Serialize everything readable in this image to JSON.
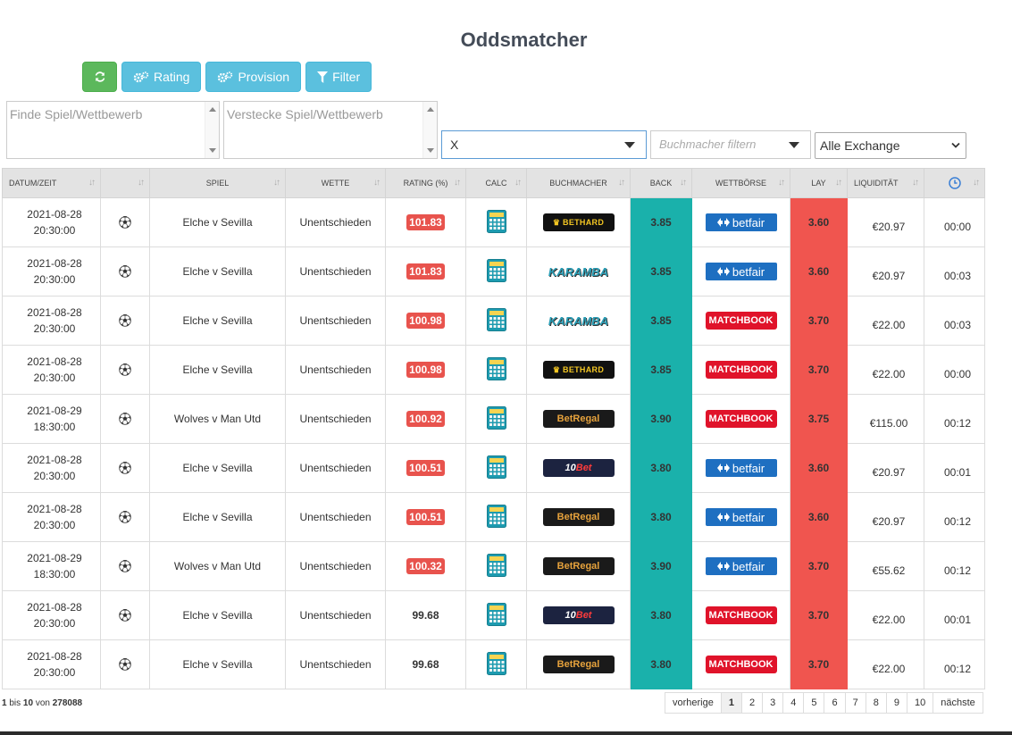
{
  "title": "Oddsmatcher",
  "toolbar": {
    "refresh_icon": "refresh-icon",
    "rating_label": "Rating",
    "provision_label": "Provision",
    "filter_label": "Filter"
  },
  "filters": {
    "find_placeholder": "Finde Spiel/Wettbewerb",
    "hide_placeholder": "Verstecke Spiel/Wettbewerb",
    "bet_select_value": "X",
    "bookmaker_placeholder": "Buchmacher filtern",
    "exchange_select_value": "Alle Exchange"
  },
  "table": {
    "headers": [
      "Datum/Zeit",
      "",
      "Spiel",
      "Wette",
      "Rating (%)",
      "Calc",
      "Buchmacher",
      "Back",
      "Wettbörse",
      "Lay",
      "Liquidität",
      ""
    ],
    "rows": [
      {
        "date": "2021-08-28",
        "time": "20:30:00",
        "game": "Elche v Sevilla",
        "bet": "Unentschieden",
        "rating": "101.83",
        "highlight": true,
        "bookmaker": "BETHARD",
        "back": "3.85",
        "exchange": "betfair",
        "lay": "3.60",
        "liquidity": "€20.97",
        "age": "00:00"
      },
      {
        "date": "2021-08-28",
        "time": "20:30:00",
        "game": "Elche v Sevilla",
        "bet": "Unentschieden",
        "rating": "101.83",
        "highlight": true,
        "bookmaker": "KARAMBA",
        "back": "3.85",
        "exchange": "betfair",
        "lay": "3.60",
        "liquidity": "€20.97",
        "age": "00:03"
      },
      {
        "date": "2021-08-28",
        "time": "20:30:00",
        "game": "Elche v Sevilla",
        "bet": "Unentschieden",
        "rating": "100.98",
        "highlight": true,
        "bookmaker": "KARAMBA",
        "back": "3.85",
        "exchange": "MATCHBOOK",
        "lay": "3.70",
        "liquidity": "€22.00",
        "age": "00:03"
      },
      {
        "date": "2021-08-28",
        "time": "20:30:00",
        "game": "Elche v Sevilla",
        "bet": "Unentschieden",
        "rating": "100.98",
        "highlight": true,
        "bookmaker": "BETHARD",
        "back": "3.85",
        "exchange": "MATCHBOOK",
        "lay": "3.70",
        "liquidity": "€22.00",
        "age": "00:00"
      },
      {
        "date": "2021-08-29",
        "time": "18:30:00",
        "game": "Wolves v Man Utd",
        "bet": "Unentschieden",
        "rating": "100.92",
        "highlight": true,
        "bookmaker": "BetRegal",
        "back": "3.90",
        "exchange": "MATCHBOOK",
        "lay": "3.75",
        "liquidity": "€115.00",
        "age": "00:12"
      },
      {
        "date": "2021-08-28",
        "time": "20:30:00",
        "game": "Elche v Sevilla",
        "bet": "Unentschieden",
        "rating": "100.51",
        "highlight": true,
        "bookmaker": "10Bet",
        "back": "3.80",
        "exchange": "betfair",
        "lay": "3.60",
        "liquidity": "€20.97",
        "age": "00:01"
      },
      {
        "date": "2021-08-28",
        "time": "20:30:00",
        "game": "Elche v Sevilla",
        "bet": "Unentschieden",
        "rating": "100.51",
        "highlight": true,
        "bookmaker": "BetRegal",
        "back": "3.80",
        "exchange": "betfair",
        "lay": "3.60",
        "liquidity": "€20.97",
        "age": "00:12"
      },
      {
        "date": "2021-08-29",
        "time": "18:30:00",
        "game": "Wolves v Man Utd",
        "bet": "Unentschieden",
        "rating": "100.32",
        "highlight": true,
        "bookmaker": "BetRegal",
        "back": "3.90",
        "exchange": "betfair",
        "lay": "3.70",
        "liquidity": "€55.62",
        "age": "00:12"
      },
      {
        "date": "2021-08-28",
        "time": "20:30:00",
        "game": "Elche v Sevilla",
        "bet": "Unentschieden",
        "rating": "99.68",
        "highlight": false,
        "bookmaker": "10Bet",
        "back": "3.80",
        "exchange": "MATCHBOOK",
        "lay": "3.70",
        "liquidity": "€22.00",
        "age": "00:01"
      },
      {
        "date": "2021-08-28",
        "time": "20:30:00",
        "game": "Elche v Sevilla",
        "bet": "Unentschieden",
        "rating": "99.68",
        "highlight": false,
        "bookmaker": "BetRegal",
        "back": "3.80",
        "exchange": "MATCHBOOK",
        "lay": "3.70",
        "liquidity": "€22.00",
        "age": "00:12"
      }
    ]
  },
  "footer": {
    "from": "1",
    "bis": "bis",
    "to": "10",
    "von": "von",
    "total": "278088"
  },
  "pagination": {
    "prev": "vorherige",
    "pages": [
      "1",
      "2",
      "3",
      "4",
      "5",
      "6",
      "7",
      "8",
      "9",
      "10"
    ],
    "active": "1",
    "next": "nächste"
  },
  "colors": {
    "back": "#1ab1ab",
    "lay": "#f0554f",
    "rating_badge": "#e8534d",
    "btn_green": "#5cb85c",
    "btn_blue": "#5bc0de"
  }
}
